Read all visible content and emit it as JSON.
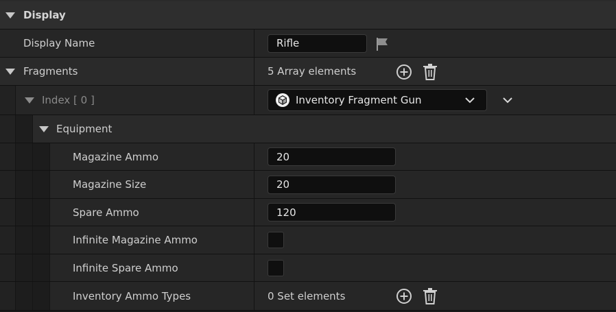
{
  "sections": {
    "display": {
      "label": "Display"
    }
  },
  "properties": {
    "display_name": {
      "label": "Display Name",
      "value": "Rifle"
    },
    "fragments": {
      "label": "Fragments",
      "summary": "5 Array elements",
      "index0": {
        "label": "Index [ 0 ]",
        "selected_class": "Inventory Fragment Gun",
        "equipment": {
          "label": "Equipment",
          "magazine_ammo": {
            "label": "Magazine Ammo",
            "value": "20"
          },
          "magazine_size": {
            "label": "Magazine Size",
            "value": "20"
          },
          "spare_ammo": {
            "label": "Spare Ammo",
            "value": "120"
          },
          "infinite_magazine_ammo": {
            "label": "Infinite Magazine Ammo",
            "checked": false
          },
          "infinite_spare_ammo": {
            "label": "Infinite Spare Ammo",
            "checked": false
          },
          "inventory_ammo_types": {
            "label": "Inventory Ammo Types",
            "summary": "0 Set elements"
          }
        }
      }
    }
  },
  "colors": {
    "panel_bg": "#1a1a1a",
    "section_bg": "#2e2e2e",
    "row_bg": "#262626",
    "input_bg": "#0f0f0f",
    "text": "#cfcfcf",
    "icon": "#d0d0d0"
  },
  "icons": {
    "flag": "flag-icon",
    "add": "add-circle-icon",
    "delete": "trash-icon",
    "expand": "triangle-down-icon",
    "chevron": "chevron-down-icon",
    "class": "cube-icon"
  }
}
